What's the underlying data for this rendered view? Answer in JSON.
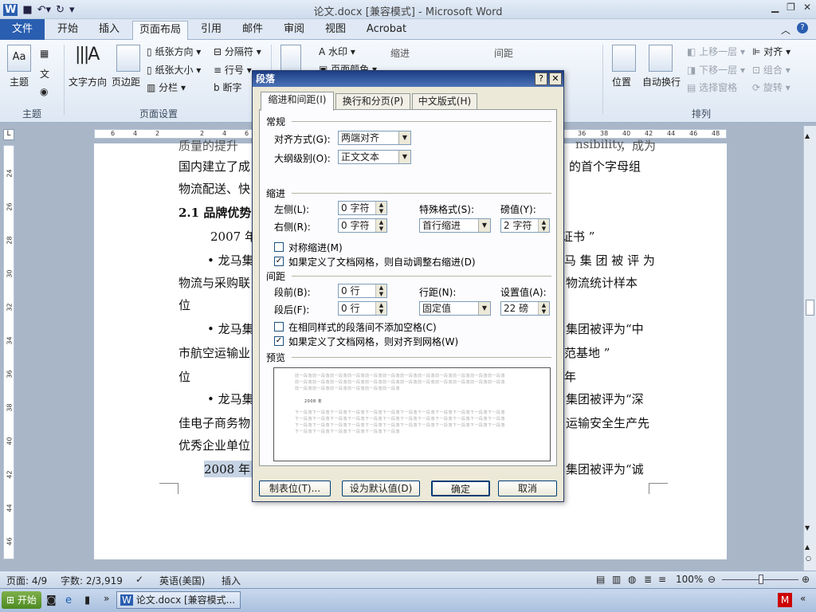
{
  "window": {
    "title": "论文.docx [兼容模式] - Microsoft Word"
  },
  "tabs": [
    {
      "label": "文件"
    },
    {
      "label": "开始"
    },
    {
      "label": "插入"
    },
    {
      "label": "页面布局"
    },
    {
      "label": "引用"
    },
    {
      "label": "邮件"
    },
    {
      "label": "审阅"
    },
    {
      "label": "视图"
    },
    {
      "label": "Acrobat"
    }
  ],
  "ribbon": {
    "theme_btn": "主题",
    "theme_group": "主题",
    "text_dir": "文字方向",
    "margins": "页边距",
    "orientation": "纸张方向",
    "size": "纸张大小",
    "columns": "分栏",
    "breaks": "分隔符",
    "line_numbers": "行号",
    "hyphen": "断字",
    "page_setup_group": "页面设置",
    "watermark": "水印",
    "page_color": "页面颜色",
    "indent_label": "缩进",
    "spacing_label": "间距",
    "position": "位置",
    "wrap": "自动换行",
    "bring_forward": "上移一层",
    "send_backward": "下移一层",
    "selection_pane": "选择窗格",
    "align": "对齐",
    "group": "组合",
    "rotate": "旋转",
    "arrange_group": "排列"
  },
  "ruler": {
    "left_nums": [
      "6",
      "4",
      "2",
      "2",
      "4",
      "6"
    ],
    "right_nums": [
      "36",
      "38",
      "40",
      "42",
      "44",
      "46",
      "48"
    ]
  },
  "vruler": {
    "nums": [
      "24",
      "26",
      "28",
      "30",
      "32",
      "34",
      "36",
      "38",
      "40",
      "42",
      "44",
      "46"
    ]
  },
  "document": {
    "line0a": "质量的提升",
    "line0b": "nsibility",
    "line0c": "，成为",
    "line1a": "国内建立了成",
    "line1b": "的首个字母组",
    "line2a": "物流配送、快",
    "line3a": "2.1  品牌优势",
    "line4a": "2007 年",
    "line4b": "证书 ”",
    "line5a": "• 龙马集",
    "line5b": "马 集 团 被 评 为",
    "line6a": "物流与采购联",
    "line6b": "物流统计样本",
    "line7a": "位",
    "line8a": "• 龙马集",
    "line8b": "集团被评为“中",
    "line9a": "市航空运输业",
    "line9b": "范基地 ”",
    "line10a": "位",
    "line10b": "年",
    "line11a": "• 龙马集",
    "line11b": "集团被评为“深",
    "line12a": "佳电子商务物",
    "line12b": "运输安全生产先",
    "line13a": "优秀企业单位",
    "line14a": "2008 年",
    "line14b": "集团被评为“诚"
  },
  "dialog": {
    "title": "段落",
    "help": "?",
    "close": "✕",
    "tabs": [
      "缩进和间距(I)",
      "换行和分页(P)",
      "中文版式(H)"
    ],
    "general": "常规",
    "alignment_label": "对齐方式(G):",
    "alignment_value": "两端对齐",
    "outline_label": "大纲级别(O):",
    "outline_value": "正文文本",
    "indent": "缩进",
    "left_label": "左侧(L):",
    "left_value": "0 字符",
    "right_label": "右侧(R):",
    "right_value": "0 字符",
    "special_label": "特殊格式(S):",
    "special_value": "首行缩进",
    "by_label": "磅值(Y):",
    "by_value": "2 字符",
    "mirror_label": "对称缩进(M)",
    "auto_right_label": "如果定义了文档网格，则自动调整右缩进(D)",
    "spacing": "间距",
    "before_label": "段前(B):",
    "before_value": "0 行",
    "after_label": "段后(F):",
    "after_value": "0 行",
    "line_label": "行距(N):",
    "line_value": "固定值",
    "at_label": "设置值(A):",
    "at_value": "22 磅",
    "no_space_label": "在相同样式的段落间不添加空格(C)",
    "snap_grid_label": "如果定义了文档网格，则对齐到网格(W)",
    "preview": "预览",
    "preview_lines": [
      "前一段落前一段落前一段落前一段落前一段落前一段落前一段落前一段落前一段落前一段落前一段落前一段落",
      "前一段落前一段落前一段落前一段落前一段落前一段落前一段落前一段落前一段落前一段落前一段落前一段落",
      "前一段落前一段落前一段落前一段落前一段落前一段落",
      "2008 年",
      "下一段落下一段落下一段落下一段落下一段落下一段落下一段落下一段落下一段落下一段落下一段落下一段落",
      "下一段落下一段落下一段落下一段落下一段落下一段落下一段落下一段落下一段落下一段落下一段落下一段落",
      "下一段落下一段落下一段落下一段落下一段落下一段落下一段落下一段落下一段落下一段落下一段落下一段落",
      "下一段落下一段落下一段落下一段落下一段落下一段落"
    ],
    "tabs_btn": "制表位(T)...",
    "default_btn": "设为默认值(D)",
    "ok_btn": "确定",
    "cancel_btn": "取消"
  },
  "status": {
    "page": "页面: 4/9",
    "words": "字数: 2/3,919",
    "lang": "英语(美国)",
    "mode": "插入",
    "zoom": "100%"
  },
  "taskbar": {
    "start": "开始",
    "task": "论文.docx [兼容模式..."
  }
}
